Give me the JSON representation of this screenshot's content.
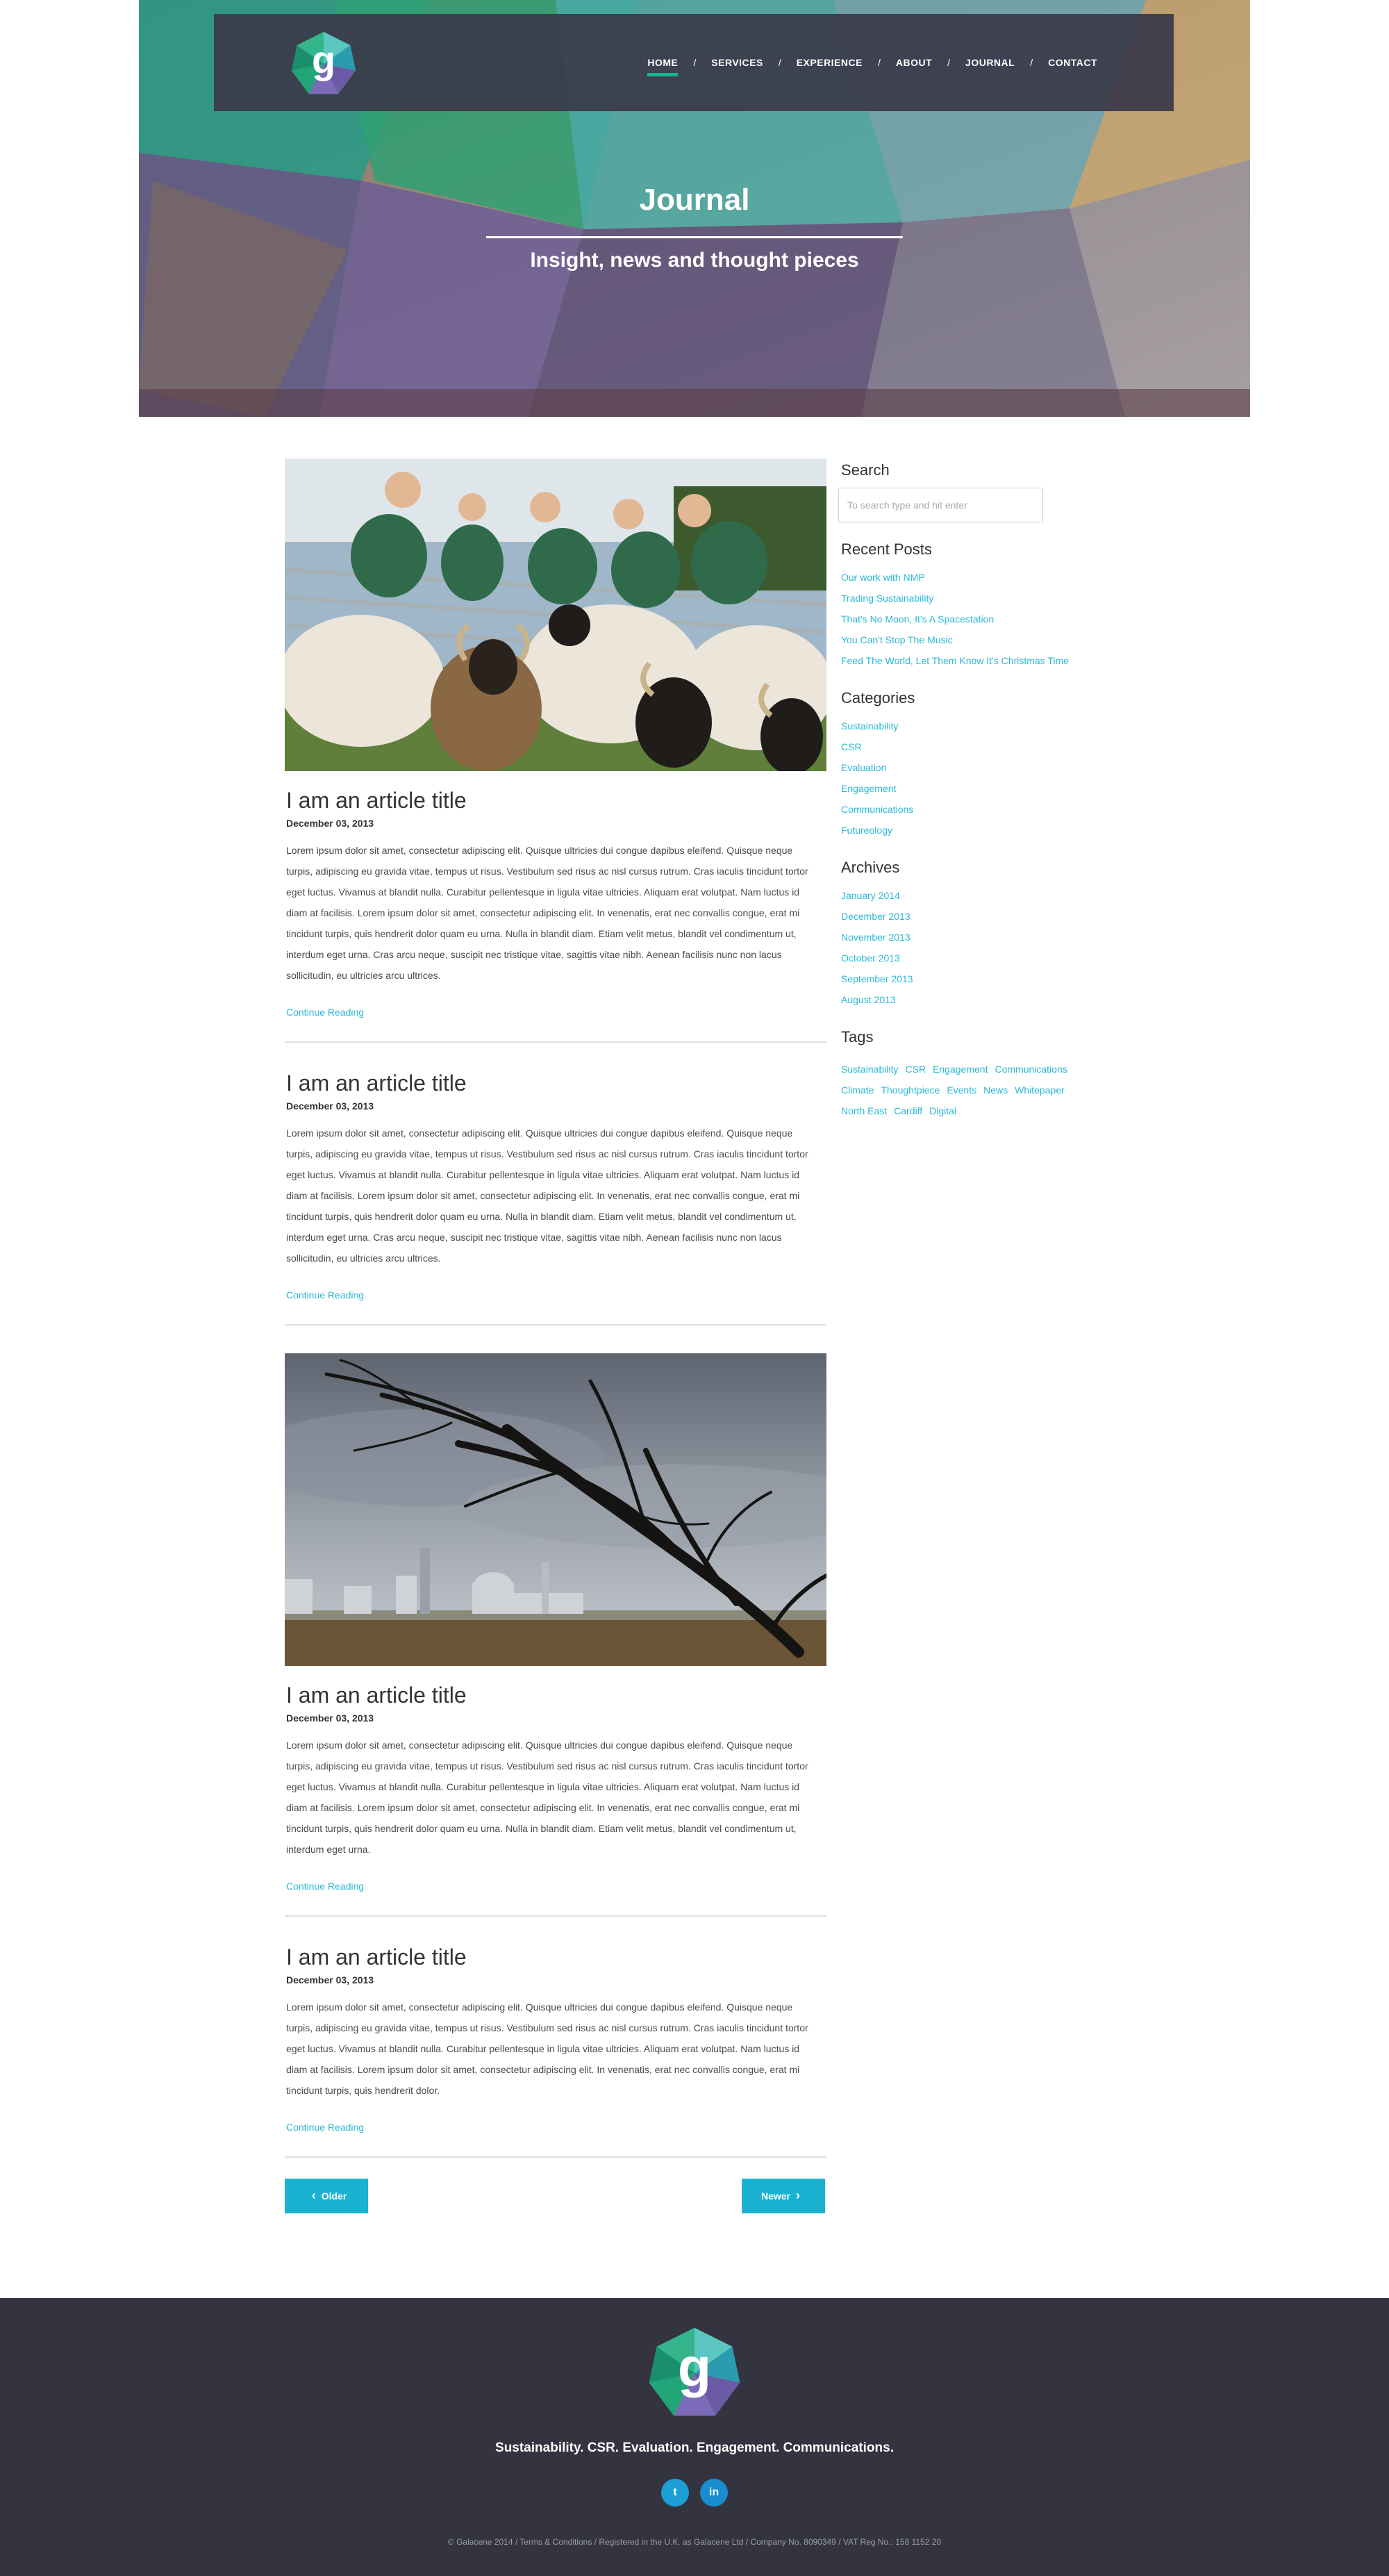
{
  "nav": {
    "items": [
      {
        "label": "HOME",
        "active": true
      },
      {
        "label": "SERVICES"
      },
      {
        "label": "EXPERIENCE"
      },
      {
        "label": "ABOUT"
      },
      {
        "label": "JOURNAL"
      },
      {
        "label": "CONTACT"
      }
    ],
    "separator": "/"
  },
  "logo": {
    "letter": "g"
  },
  "hero": {
    "title": "Journal",
    "subtitle": "Insight, news and thought pieces"
  },
  "articles": [
    {
      "has_image": true,
      "image": "sheep-farmers-photo",
      "title": "I am an article title",
      "date": "December 03, 2013",
      "body": "Lorem ipsum dolor sit amet, consectetur adipiscing elit. Quisque ultricies dui congue dapibus eleifend. Quisque neque turpis, adipiscing eu gravida vitae, tempus ut risus. Vestibulum sed risus ac nisl cursus rutrum. Cras iaculis tincidunt tortor eget luctus. Vivamus at blandit nulla. Curabitur pellentesque in ligula vitae ultricies. Aliquam erat volutpat. Nam luctus id diam at facilisis. Lorem ipsum dolor sit amet, consectetur adipiscing elit. In venenatis, erat nec convallis congue, erat mi tincidunt turpis, quis hendrerit dolor quam eu urna. Nulla in blandit diam. Etiam velit metus, blandit vel condimentum ut, interdum eget urna. Cras arcu neque, suscipit nec tristique vitae, sagittis vitae nibh. Aenean facilisis nunc non lacus sollicitudin, eu ultricies arcu ultrices.",
      "link": "Continue Reading"
    },
    {
      "has_image": false,
      "title": "I am an article title",
      "date": "December 03, 2013",
      "body": "Lorem ipsum dolor sit amet, consectetur adipiscing elit. Quisque ultricies dui congue dapibus eleifend. Quisque neque turpis, adipiscing eu gravida vitae, tempus ut risus. Vestibulum sed risus ac nisl cursus rutrum. Cras iaculis tincidunt tortor eget luctus. Vivamus at blandit nulla. Curabitur pellentesque in ligula vitae ultricies. Aliquam erat volutpat. Nam luctus id diam at facilisis. Lorem ipsum dolor sit amet, consectetur adipiscing elit. In venenatis, erat nec convallis congue, erat mi tincidunt turpis, quis hendrerit dolor quam eu urna. Nulla in blandit diam. Etiam velit metus, blandit vel condimentum ut, interdum eget urna. Cras arcu neque, suscipit nec tristique vitae, sagittis vitae nibh. Aenean facilisis nunc non lacus sollicitudin, eu ultricies arcu ultrices.",
      "link": "Continue Reading"
    },
    {
      "has_image": true,
      "image": "windswept-tree-power-station-photo",
      "title": "I am an article title",
      "date": "December 03, 2013",
      "body": "Lorem ipsum dolor sit amet, consectetur adipiscing elit. Quisque ultricies dui congue dapibus eleifend. Quisque neque turpis, adipiscing eu gravida vitae, tempus ut risus. Vestibulum sed risus ac nisl cursus rutrum. Cras iaculis tincidunt tortor eget luctus. Vivamus at blandit nulla. Curabitur pellentesque in ligula vitae ultricies. Aliquam erat volutpat. Nam luctus id diam at facilisis. Lorem ipsum dolor sit amet, consectetur adipiscing elit. In venenatis, erat nec convallis congue, erat mi tincidunt turpis, quis hendrerit dolor quam eu urna. Nulla in blandit diam. Etiam velit metus, blandit vel condimentum ut, interdum eget urna.",
      "link": "Continue Reading"
    },
    {
      "has_image": false,
      "title": "I am an article title",
      "date": "December 03, 2013",
      "body": "Lorem ipsum dolor sit amet, consectetur adipiscing elit. Quisque ultricies dui congue dapibus eleifend. Quisque neque turpis, adipiscing eu gravida vitae, tempus ut risus. Vestibulum sed risus ac nisl cursus rutrum. Cras iaculis tincidunt tortor eget luctus. Vivamus at blandit nulla. Curabitur pellentesque in ligula vitae ultricies. Aliquam erat volutpat. Nam luctus id diam at facilisis. Lorem ipsum dolor sit amet, consectetur adipiscing elit. In venenatis, erat nec convallis congue, erat mi tincidunt turpis, quis hendrerit dolor.",
      "link": "Continue Reading"
    }
  ],
  "pagination": {
    "older": "Older",
    "newer": "Newer"
  },
  "sidebar": {
    "search": {
      "heading": "Search",
      "placeholder": "To search type and hit enter"
    },
    "recent": {
      "heading": "Recent Posts",
      "items": [
        "Our work with NMP",
        "Trading Sustainability",
        "That's No Moon, It's A Spacestation",
        "You Can't Stop The Music",
        "Feed The World, Let Them Know It's Christmas Time"
      ]
    },
    "categories": {
      "heading": "Categories",
      "items": [
        "Sustainability",
        "CSR",
        "Evaluation",
        "Engagement",
        "Communications",
        "Futureology"
      ]
    },
    "archives": {
      "heading": "Archives",
      "items": [
        "January 2014",
        "December 2013",
        "November 2013",
        "October 2013",
        "September 2013",
        "August 2013"
      ]
    },
    "tags": {
      "heading": "Tags",
      "items": [
        "Sustainability",
        "CSR",
        "Engagement",
        "Communications",
        "Climate",
        "Thoughtpiece",
        "Events",
        "News",
        "Whitepaper",
        "North East",
        "Cardiff",
        "Digital"
      ]
    }
  },
  "footer": {
    "tagline": "Sustainability. CSR. Evaluation. Engagement. Communications.",
    "social": [
      {
        "name": "twitter-icon",
        "glyph": "t"
      },
      {
        "name": "linkedin-icon",
        "glyph": "in"
      }
    ],
    "copyright": "© Galacene 2014  /  Terms & Conditions  /  Registered in the U.K. as Galacene Ltd  /  Company No. 8090349 / VAT Reg No.: 158 1152 20"
  },
  "colors": {
    "accent": "#2bb8d6",
    "button": "#1bb2d2",
    "footer_bg": "#33343f",
    "nav_bg": "#3a3a4a",
    "nav_active": "#1ab394"
  }
}
